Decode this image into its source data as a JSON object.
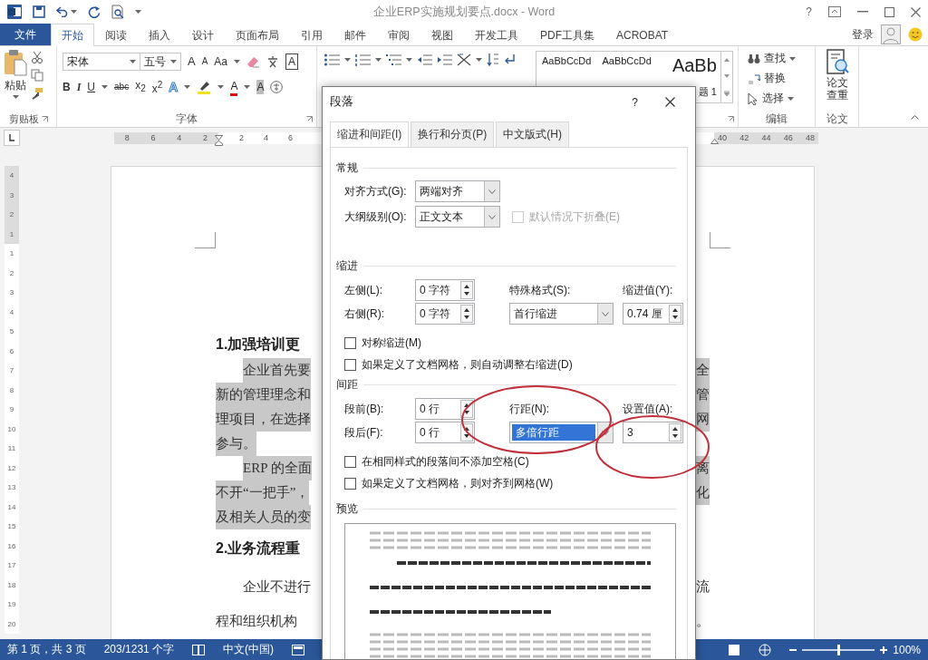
{
  "title_bar": {
    "title": "企业ERP实施规划要点.docx - Word",
    "help": "?"
  },
  "file_tab": {
    "label": "文件"
  },
  "ribbon_tabs": [
    {
      "label": "开始",
      "selected": true
    },
    {
      "label": "阅读",
      "selected": false
    },
    {
      "label": "插入",
      "selected": false
    },
    {
      "label": "设计",
      "selected": false
    },
    {
      "label": "页面布局",
      "selected": false
    },
    {
      "label": "引用",
      "selected": false
    },
    {
      "label": "邮件",
      "selected": false
    },
    {
      "label": "审阅",
      "selected": false
    },
    {
      "label": "视图",
      "selected": false
    },
    {
      "label": "开发工具",
      "selected": false
    },
    {
      "label": "PDF工具集",
      "selected": false
    },
    {
      "label": "ACROBAT",
      "selected": false
    }
  ],
  "account": {
    "sign_in": "登录"
  },
  "ribbon": {
    "clipboard": {
      "paste": "粘贴",
      "label": "剪贴板"
    },
    "font": {
      "name": "宋体",
      "size": "五号",
      "label": "字体",
      "row1": [
        {
          "kind": "grow",
          "glyph": "A"
        },
        {
          "kind": "shrink",
          "glyph": "A"
        },
        {
          "kind": "case",
          "glyph": "Aa",
          "has_menu": true
        },
        {
          "kind": "clear"
        },
        {
          "kind": "phonetic"
        },
        {
          "kind": "border",
          "glyph": "A"
        }
      ],
      "row2": [
        {
          "kind": "bold",
          "glyph": "B"
        },
        {
          "kind": "italic",
          "glyph": "I"
        },
        {
          "kind": "underline",
          "glyph": "U",
          "has_menu": true
        },
        {
          "kind": "strike",
          "glyph": "abc"
        },
        {
          "kind": "sub",
          "glyph": "x$_{2}$"
        },
        {
          "kind": "sup",
          "glyph": "x$^{2}$"
        },
        {
          "kind": "effect",
          "glyph": "A",
          "has_menu": true
        },
        {
          "kind": "highlight",
          "has_menu": true
        },
        {
          "kind": "color",
          "glyph": "A",
          "has_menu": true
        },
        {
          "kind": "shading",
          "glyph": "A"
        },
        {
          "kind": "enclose"
        }
      ]
    },
    "styles": [
      {
        "preview": "AaBbCcDd"
      },
      {
        "preview": "AaBbCcDd"
      },
      {
        "preview": "AaBb",
        "caption": "题 1"
      }
    ],
    "editing": {
      "label": "编辑",
      "items": [
        {
          "label": "查找",
          "has_menu": true
        },
        {
          "label": "替换",
          "has_menu": false
        },
        {
          "label": "选择",
          "has_menu": true
        }
      ]
    },
    "paper": {
      "button": "论文查重",
      "label": "论文"
    }
  },
  "ruler": {
    "left_numbers": [
      "8",
      "6",
      "4",
      "2"
    ],
    "middle_numbers": [
      "2",
      "4",
      "6"
    ],
    "right_numbers": [
      "40",
      "42",
      "44",
      "46",
      "48"
    ],
    "vertical_numbers": [
      "4",
      "3",
      "2",
      "1",
      "1",
      "2",
      "3",
      "4",
      "5",
      "6",
      "7",
      "8",
      "9",
      "10",
      "11",
      "12",
      "13",
      "14",
      "15",
      "16",
      "17",
      "18",
      "19",
      "20"
    ]
  },
  "document": {
    "paragraphs": [
      {
        "kind": "heading",
        "highlighted": false,
        "lines": [
          {
            "left": "1.加强培训更"
          }
        ]
      },
      {
        "kind": "body",
        "highlighted": true,
        "lines": [
          {
            "left": "企业首先要",
            "right": "全"
          },
          {
            "left": "新的管理理念和",
            "right": "管"
          },
          {
            "left": "理项目，在选择",
            "right": "网"
          },
          {
            "left": "参与。"
          }
        ]
      },
      {
        "kind": "body",
        "highlighted": true,
        "lines": [
          {
            "left": "ERP 的全面",
            "right": "离"
          },
          {
            "left": "不开“一把手”，",
            "right": "化"
          },
          {
            "left": "及相关人员的变"
          }
        ]
      },
      {
        "kind": "heading",
        "highlighted": false,
        "lines": [
          {
            "left": "2.业务流程重"
          }
        ]
      },
      {
        "kind": "body_wide",
        "highlighted": false,
        "lines": [
          {
            "left": "企业不进行",
            "right": "流"
          },
          {
            "left": "程和组织机构",
            "right": "。"
          }
        ]
      }
    ]
  },
  "status_bar": {
    "page": "第 1 页，共 3 页",
    "words": "203/1231 个字",
    "language": "中文(中国)",
    "zoom": {
      "level": 0.5,
      "reading": "100%"
    }
  },
  "dialog": {
    "title": "段落",
    "help": "?",
    "tabs": [
      {
        "label": "缩进和间距(I)",
        "selected": true
      },
      {
        "label": "换行和分页(P)",
        "selected": false
      },
      {
        "label": "中文版式(H)",
        "selected": false
      }
    ],
    "general": {
      "heading": "常规",
      "alignment": {
        "label": "对齐方式(G):",
        "value": "两端对齐",
        "kind": "dropdown"
      },
      "outline": {
        "label": "大纲级别(O):",
        "value": "正文文本",
        "kind": "dropdown"
      },
      "collapse": {
        "label": "默认情况下折叠(E)",
        "checked": false,
        "disabled": true
      }
    },
    "indent": {
      "heading": "缩进",
      "first": {
        "label": "左侧(L):",
        "value": "0 字符",
        "kind": "spin"
      },
      "second": {
        "label": "右侧(R):",
        "value": "0 字符",
        "kind": "spin"
      },
      "third": {
        "label": "特殊格式(S):",
        "value": "首行缩进",
        "kind": "dropdown"
      },
      "fourth": {
        "label": "缩进值(Y):",
        "value": "0.74 厘",
        "kind": "spin"
      },
      "options": [
        {
          "label": "对称缩进(M)",
          "checked": false,
          "disabled": false
        },
        {
          "label": "如果定义了文档网格，则自动调整右缩进(D)",
          "checked": false,
          "disabled": false
        }
      ]
    },
    "spacing": {
      "heading": "间距",
      "first": {
        "label": "段前(B):",
        "value": "0 行",
        "kind": "spin"
      },
      "second": {
        "label": "段后(F):",
        "value": "0 行",
        "kind": "spin"
      },
      "third": {
        "label": "行距(N):",
        "value": "多倍行距",
        "kind": "dropdown",
        "selected": true
      },
      "fourth": {
        "label": "设置值(A):",
        "value": "3",
        "kind": "spin"
      },
      "options": [
        {
          "label": "在相同样式的段落间不添加空格(C)",
          "checked": false,
          "disabled": false
        },
        {
          "label": "如果定义了文档网格，则对齐到网格(W)",
          "checked": false,
          "disabled": false
        }
      ]
    },
    "preview": {
      "heading": "预览"
    }
  }
}
